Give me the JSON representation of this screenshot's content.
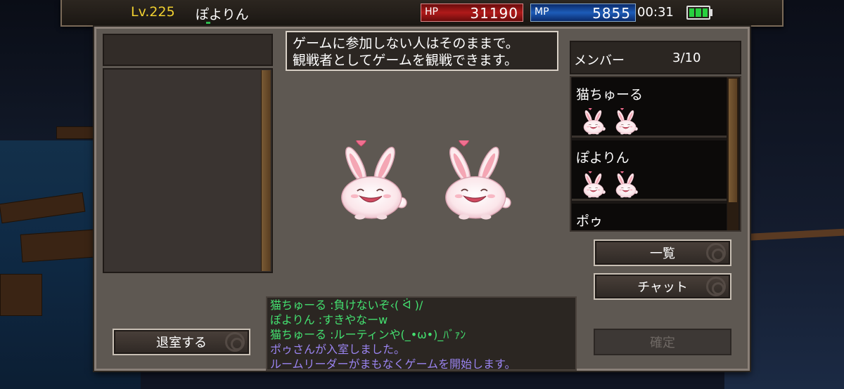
{
  "status": {
    "level": "Lv.225",
    "player_name": "ぽよりん",
    "hp_label": "HP",
    "hp_value": "31190",
    "mp_label": "MP",
    "mp_value": "5855",
    "clock": "00:31",
    "battery_icon": "battery-icon",
    "colors": {
      "level": "#f0d030",
      "hp": "#b01a1a",
      "mp": "#1d5cb8",
      "battery": "#28d040"
    }
  },
  "notice": {
    "line1": "ゲームに参加しない人はそのままで。",
    "line2": "観戦者としてゲームを観戦できます。"
  },
  "members": {
    "label": "メンバー",
    "count": "3/10",
    "list": [
      {
        "name": "猫ちゅーる",
        "icons": 2
      },
      {
        "name": "ぽよりん",
        "icons": 2
      },
      {
        "name": "ポゥ",
        "icons": 0
      }
    ]
  },
  "buttons": {
    "list": "一覧",
    "chat": "チャット",
    "confirm": "確定",
    "leave": "退室する"
  },
  "chat": [
    {
      "text": "猫ちゅーる :負けないぞ‹( ᐛ )/",
      "color": "green"
    },
    {
      "text": "ぽよりん :すきやなーw",
      "color": "green"
    },
    {
      "text": "猫ちゅーる :ルーティンや(_•ω•)_ﾊﾞｧﾝ",
      "color": "green"
    },
    {
      "text": "ポゥさんが入室しました。",
      "color": "purple"
    },
    {
      "text": "ルームリーダーがまもなくゲームを開始します。",
      "color": "purple"
    }
  ]
}
